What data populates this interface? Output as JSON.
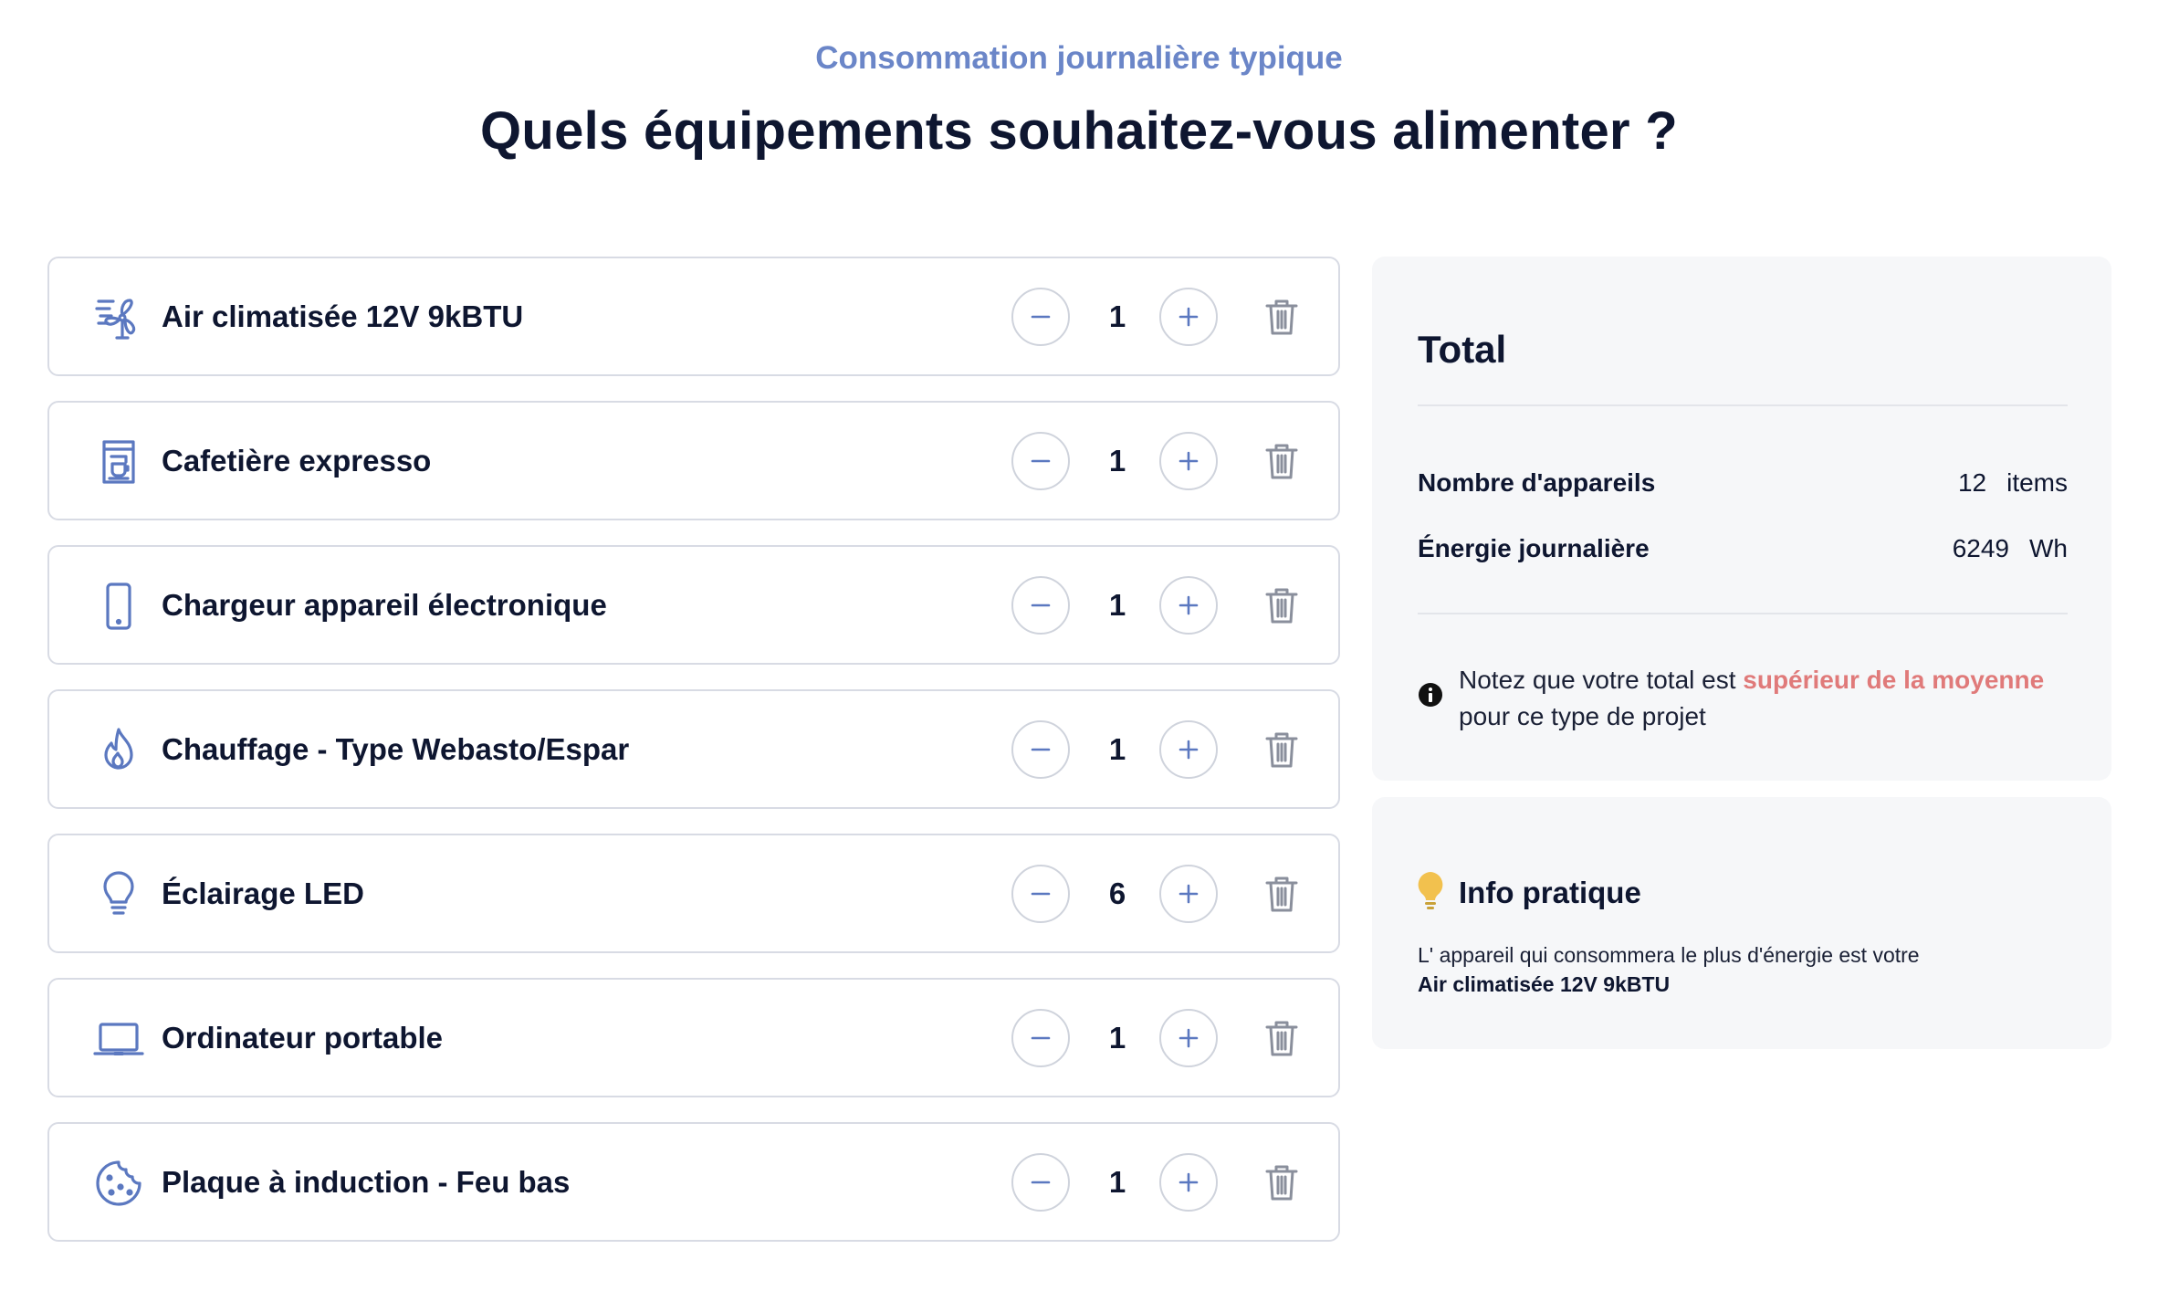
{
  "header": {
    "subtitle": "Consommation journalière typique",
    "title": "Quels équipements souhaitez-vous alimenter ?"
  },
  "items": [
    {
      "name": "Air climatisée 12V 9kBTU",
      "qty": "1",
      "icon": "air-conditioner-icon"
    },
    {
      "name": "Cafetière expresso",
      "qty": "1",
      "icon": "coffee-machine-icon"
    },
    {
      "name": "Chargeur appareil électronique",
      "qty": "1",
      "icon": "phone-icon"
    },
    {
      "name": "Chauffage - Type Webasto/Espar",
      "qty": "1",
      "icon": "flame-icon"
    },
    {
      "name": "Éclairage LED",
      "qty": "6",
      "icon": "lightbulb-icon"
    },
    {
      "name": "Ordinateur portable",
      "qty": "1",
      "icon": "laptop-icon"
    },
    {
      "name": "Plaque à induction - Feu bas",
      "qty": "1",
      "icon": "cooktop-icon"
    }
  ],
  "total": {
    "title": "Total",
    "devices_label": "Nombre d'appareils",
    "devices_value": "12",
    "devices_unit": "items",
    "energy_label": "Énergie journalière",
    "energy_value": "6249",
    "energy_unit": "Wh",
    "note_prefix": "Notez que votre total est ",
    "note_highlight": "supérieur de la moyenne",
    "note_suffix": "pour ce type de projet"
  },
  "info": {
    "title": "Info pratique",
    "line1": "L' appareil qui consommera le plus d'énergie est votre",
    "line2": "Air climatisée 12V 9kBTU"
  },
  "colors": {
    "accent": "#6b86c8",
    "highlight": "#e07a7a",
    "bulb": "#f2c14e",
    "border": "#d8dbe4",
    "panel_bg": "#f6f7f9"
  }
}
